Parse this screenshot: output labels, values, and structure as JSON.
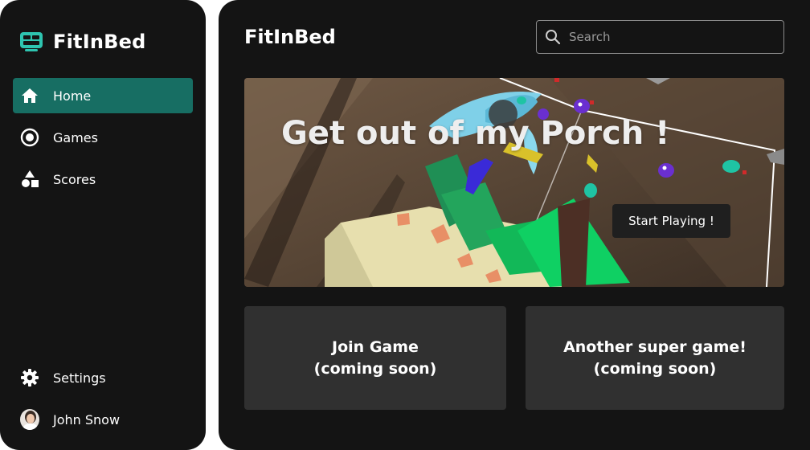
{
  "app": {
    "name": "FitInBed"
  },
  "colors": {
    "sidebar_bg": "#141414",
    "accent": "#176e63",
    "brand_icon": "#2ec4b0",
    "card_bg": "#303030"
  },
  "sidebar": {
    "items": [
      {
        "label": "Home",
        "icon": "home-icon",
        "active": true
      },
      {
        "label": "Games",
        "icon": "target-icon",
        "active": false
      },
      {
        "label": "Scores",
        "icon": "shapes-icon",
        "active": false
      }
    ],
    "bottom": [
      {
        "label": "Settings",
        "icon": "gear-icon"
      },
      {
        "label": "John Snow",
        "icon": "avatar"
      }
    ]
  },
  "header": {
    "title": "FitInBed",
    "search": {
      "placeholder": "Search",
      "value": ""
    }
  },
  "hero": {
    "title": "Get out of my Porch !",
    "button_label": "Start Playing !"
  },
  "cards": [
    {
      "line1": "Join Game",
      "line2": "(coming soon)"
    },
    {
      "line1": "Another super game!",
      "line2": "(coming soon)"
    }
  ]
}
